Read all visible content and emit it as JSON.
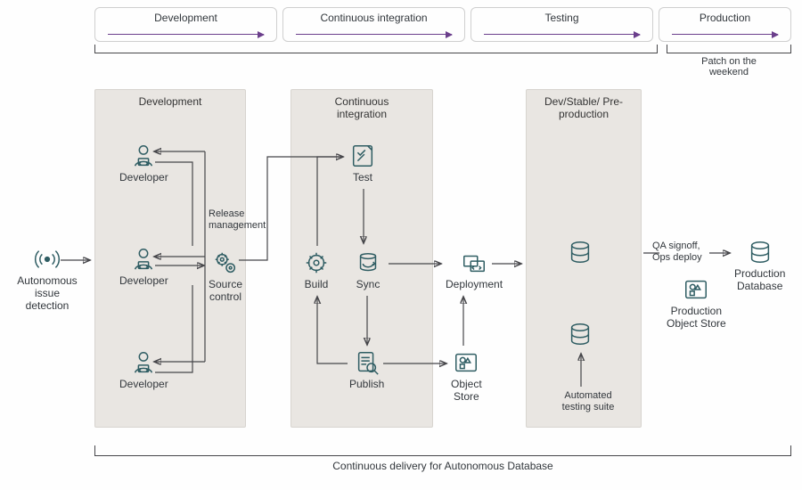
{
  "phases": {
    "p1": "Development",
    "p2": "Continuous integration",
    "p3": "Testing",
    "p4": "Production"
  },
  "top_bracket_right": "Patch on the\nweekend",
  "bands": {
    "dev": "Development",
    "ci": "Continuous integration",
    "pre": "Dev/Stable/\nPre-production"
  },
  "nodes": {
    "aid": "Autonomous\nissue\ndetection",
    "dev1": "Developer",
    "dev2": "Developer",
    "dev3": "Developer",
    "source": "Source\ncontrol",
    "release": "Release\nmanagement",
    "test": "Test",
    "build": "Build",
    "sync": "Sync",
    "publish": "Publish",
    "deploy": "Deployment",
    "ostore": "Object\nStore",
    "autotest": "Automated\ntesting suite",
    "qa": "QA signoff,\nOps deploy",
    "pobj": "Production\nObject Store",
    "pdb": "Production\nDatabase"
  },
  "bottom_caption": "Continuous delivery for Autonomous Database"
}
